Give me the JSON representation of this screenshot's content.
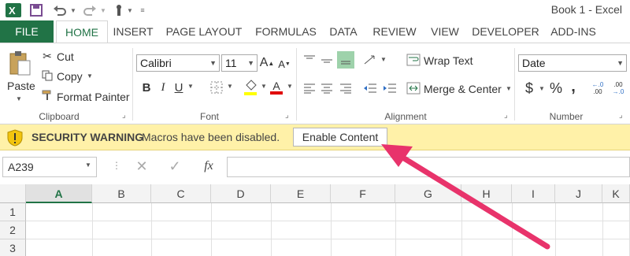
{
  "window": {
    "title": "Book 1 - Excel"
  },
  "quick_access": {
    "excel_logo": "excel-logo",
    "save": "save-icon",
    "undo": "undo-icon",
    "redo": "redo-icon",
    "touch": "touch-mode-icon"
  },
  "tabs": [
    {
      "label": "FILE"
    },
    {
      "label": "HOME"
    },
    {
      "label": "INSERT"
    },
    {
      "label": "PAGE LAYOUT"
    },
    {
      "label": "FORMULAS"
    },
    {
      "label": "DATA"
    },
    {
      "label": "REVIEW"
    },
    {
      "label": "VIEW"
    },
    {
      "label": "DEVELOPER"
    },
    {
      "label": "ADD-INS"
    }
  ],
  "ribbon": {
    "clipboard": {
      "paste": "Paste",
      "cut": "Cut",
      "copy": "Copy",
      "format_painter": "Format Painter",
      "label": "Clipboard"
    },
    "font": {
      "name": "Calibri",
      "size": "11",
      "bold": "B",
      "italic": "I",
      "underline": "U",
      "label": "Font"
    },
    "alignment": {
      "wrap_text": "Wrap Text",
      "merge_center": "Merge & Center",
      "label": "Alignment"
    },
    "number": {
      "format": "Date",
      "currency": "$",
      "percent": "%",
      "comma": ",",
      "label": "Number"
    }
  },
  "security": {
    "title": "SECURITY WARNING",
    "message": "Macros have been disabled.",
    "button": "Enable Content"
  },
  "formula_bar": {
    "name_box": "A239",
    "fx": "fx"
  },
  "grid": {
    "columns": [
      "A",
      "B",
      "C",
      "D",
      "E",
      "F",
      "G",
      "H",
      "I",
      "J",
      "K"
    ],
    "rows": [
      "1",
      "2",
      "3"
    ]
  },
  "colors": {
    "excel_green": "#217346",
    "warning_bg": "#fff1a8",
    "annotation_arrow": "#e8336b"
  }
}
